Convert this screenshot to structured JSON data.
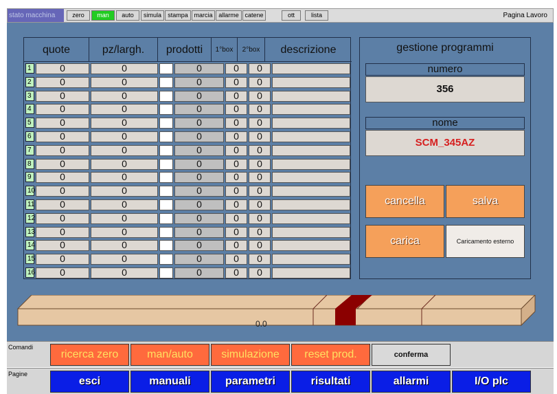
{
  "topbar": {
    "status": "stato macchina",
    "buttons": [
      "zero",
      "man",
      "auto",
      "simula",
      "stampa",
      "marcia",
      "allarme",
      "catene",
      "ott",
      "lista"
    ],
    "active_index": 1,
    "page_label": "Pagina Lavoro"
  },
  "table": {
    "headers": [
      "quote",
      "pz/largh.",
      "prodotti",
      "1°box",
      "2°box",
      "descrizione"
    ],
    "rows": [
      {
        "n": "1",
        "quote": "0",
        "pz": "0",
        "prod": "0",
        "b1": "0",
        "b2": "0",
        "desc": ""
      },
      {
        "n": "2",
        "quote": "0",
        "pz": "0",
        "prod": "0",
        "b1": "0",
        "b2": "0",
        "desc": ""
      },
      {
        "n": "3",
        "quote": "0",
        "pz": "0",
        "prod": "0",
        "b1": "0",
        "b2": "0",
        "desc": ""
      },
      {
        "n": "4",
        "quote": "0",
        "pz": "0",
        "prod": "0",
        "b1": "0",
        "b2": "0",
        "desc": ""
      },
      {
        "n": "5",
        "quote": "0",
        "pz": "0",
        "prod": "0",
        "b1": "0",
        "b2": "0",
        "desc": ""
      },
      {
        "n": "6",
        "quote": "0",
        "pz": "0",
        "prod": "0",
        "b1": "0",
        "b2": "0",
        "desc": ""
      },
      {
        "n": "7",
        "quote": "0",
        "pz": "0",
        "prod": "0",
        "b1": "0",
        "b2": "0",
        "desc": ""
      },
      {
        "n": "8",
        "quote": "0",
        "pz": "0",
        "prod": "0",
        "b1": "0",
        "b2": "0",
        "desc": ""
      },
      {
        "n": "9",
        "quote": "0",
        "pz": "0",
        "prod": "0",
        "b1": "0",
        "b2": "0",
        "desc": ""
      },
      {
        "n": "10",
        "quote": "0",
        "pz": "0",
        "prod": "0",
        "b1": "0",
        "b2": "0",
        "desc": ""
      },
      {
        "n": "11",
        "quote": "0",
        "pz": "0",
        "prod": "0",
        "b1": "0",
        "b2": "0",
        "desc": ""
      },
      {
        "n": "12",
        "quote": "0",
        "pz": "0",
        "prod": "0",
        "b1": "0",
        "b2": "0",
        "desc": ""
      },
      {
        "n": "13",
        "quote": "0",
        "pz": "0",
        "prod": "0",
        "b1": "0",
        "b2": "0",
        "desc": ""
      },
      {
        "n": "14",
        "quote": "0",
        "pz": "0",
        "prod": "0",
        "b1": "0",
        "b2": "0",
        "desc": ""
      },
      {
        "n": "15",
        "quote": "0",
        "pz": "0",
        "prod": "0",
        "b1": "0",
        "b2": "0",
        "desc": ""
      },
      {
        "n": "16",
        "quote": "0",
        "pz": "0",
        "prod": "0",
        "b1": "0",
        "b2": "0",
        "desc": ""
      }
    ]
  },
  "gestione": {
    "title": "gestione programmi",
    "numero_label": "numero",
    "numero_value": "356",
    "nome_label": "nome",
    "nome_value": "SCM_345AZ",
    "buttons": {
      "cancella": "cancella",
      "salva": "salva",
      "carica": "carica",
      "esterno": "Caricamento esterno"
    }
  },
  "conveyor": {
    "value": "0.0"
  },
  "comandi": {
    "label": "Comandi",
    "buttons": [
      "ricerca zero",
      "man/auto",
      "simulazione",
      "reset prod.",
      "conferma"
    ]
  },
  "pagine": {
    "label": "Pagine",
    "buttons": [
      "esci",
      "manuali",
      "parametri",
      "risultati",
      "allarmi",
      "I/O plc"
    ]
  },
  "colors": {
    "panel_bg": "#5c7fa6",
    "active_green": "#22cc22",
    "orange_btn": "#f5a05a",
    "cmd_orange": "#ff6a3d",
    "nav_blue": "#0a1ee6",
    "name_red": "#d62020"
  }
}
